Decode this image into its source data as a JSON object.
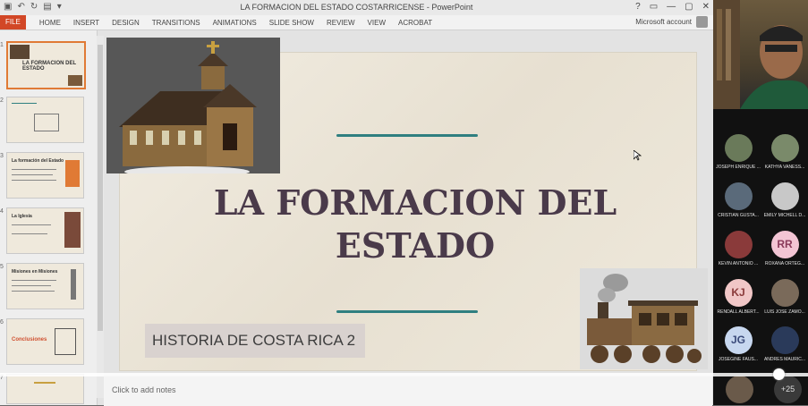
{
  "window": {
    "title": "LA FORMACION DEL ESTADO COSTARRICENSE - PowerPoint",
    "account": "Microsoft account",
    "controls": [
      "?",
      "▭",
      "—",
      "▢",
      "✕"
    ]
  },
  "ribbon": {
    "tabs": [
      "FILE",
      "HOME",
      "INSERT",
      "DESIGN",
      "TRANSITIONS",
      "ANIMATIONS",
      "SLIDE SHOW",
      "REVIEW",
      "VIEW",
      "ACROBAT"
    ]
  },
  "thumbnails": {
    "numbers": [
      "1",
      "2",
      "3",
      "4",
      "5",
      "6",
      "7"
    ],
    "titles": [
      "LA FORMACION DEL ESTADO",
      "",
      "La formación del Estado",
      "La Iglesia",
      "Misiones en Misiones",
      "Conclusiones",
      ""
    ]
  },
  "slide": {
    "title_line1": "LA FORMACION DEL",
    "title_line2": "ESTADO",
    "subtitle": "HISTORIA DE COSTA RICA 2"
  },
  "notes": {
    "placeholder": "Click to add notes"
  },
  "participants": [
    {
      "name": "JOSEPH ENRIQUE ...",
      "type": "photo",
      "color": "#6a7a5a"
    },
    {
      "name": "KATHYA VANESS...",
      "type": "photo",
      "color": "#7a8a6a"
    },
    {
      "name": "CRISTIAN GUSTA...",
      "type": "photo",
      "color": "#5a6a7a"
    },
    {
      "name": "EMILY MICHELL D...",
      "type": "photo",
      "color": "#c8c8c8"
    },
    {
      "name": "KEVIN ANTONIO ...",
      "type": "photo",
      "color": "#8a3a3a"
    },
    {
      "name": "ROXANA ORTEG...",
      "type": "initials",
      "initials": "RR",
      "color": "#f3c5d4",
      "text": "#8a3a5a"
    },
    {
      "name": "RENDALL ALBERT...",
      "type": "initials",
      "initials": "KJ",
      "color": "#f1c7c7",
      "text": "#8a3a3a"
    },
    {
      "name": "LUIS JOSE ZAMO...",
      "type": "photo",
      "color": "#7a6a5a"
    },
    {
      "name": "JOSEGINE FAUS...",
      "type": "initials",
      "initials": "JG",
      "color": "#c7d7ef",
      "text": "#3a4a7a"
    },
    {
      "name": "ANDRES MAURIC...",
      "type": "photo",
      "color": "#2a3a5a"
    }
  ],
  "more_count": "+25"
}
